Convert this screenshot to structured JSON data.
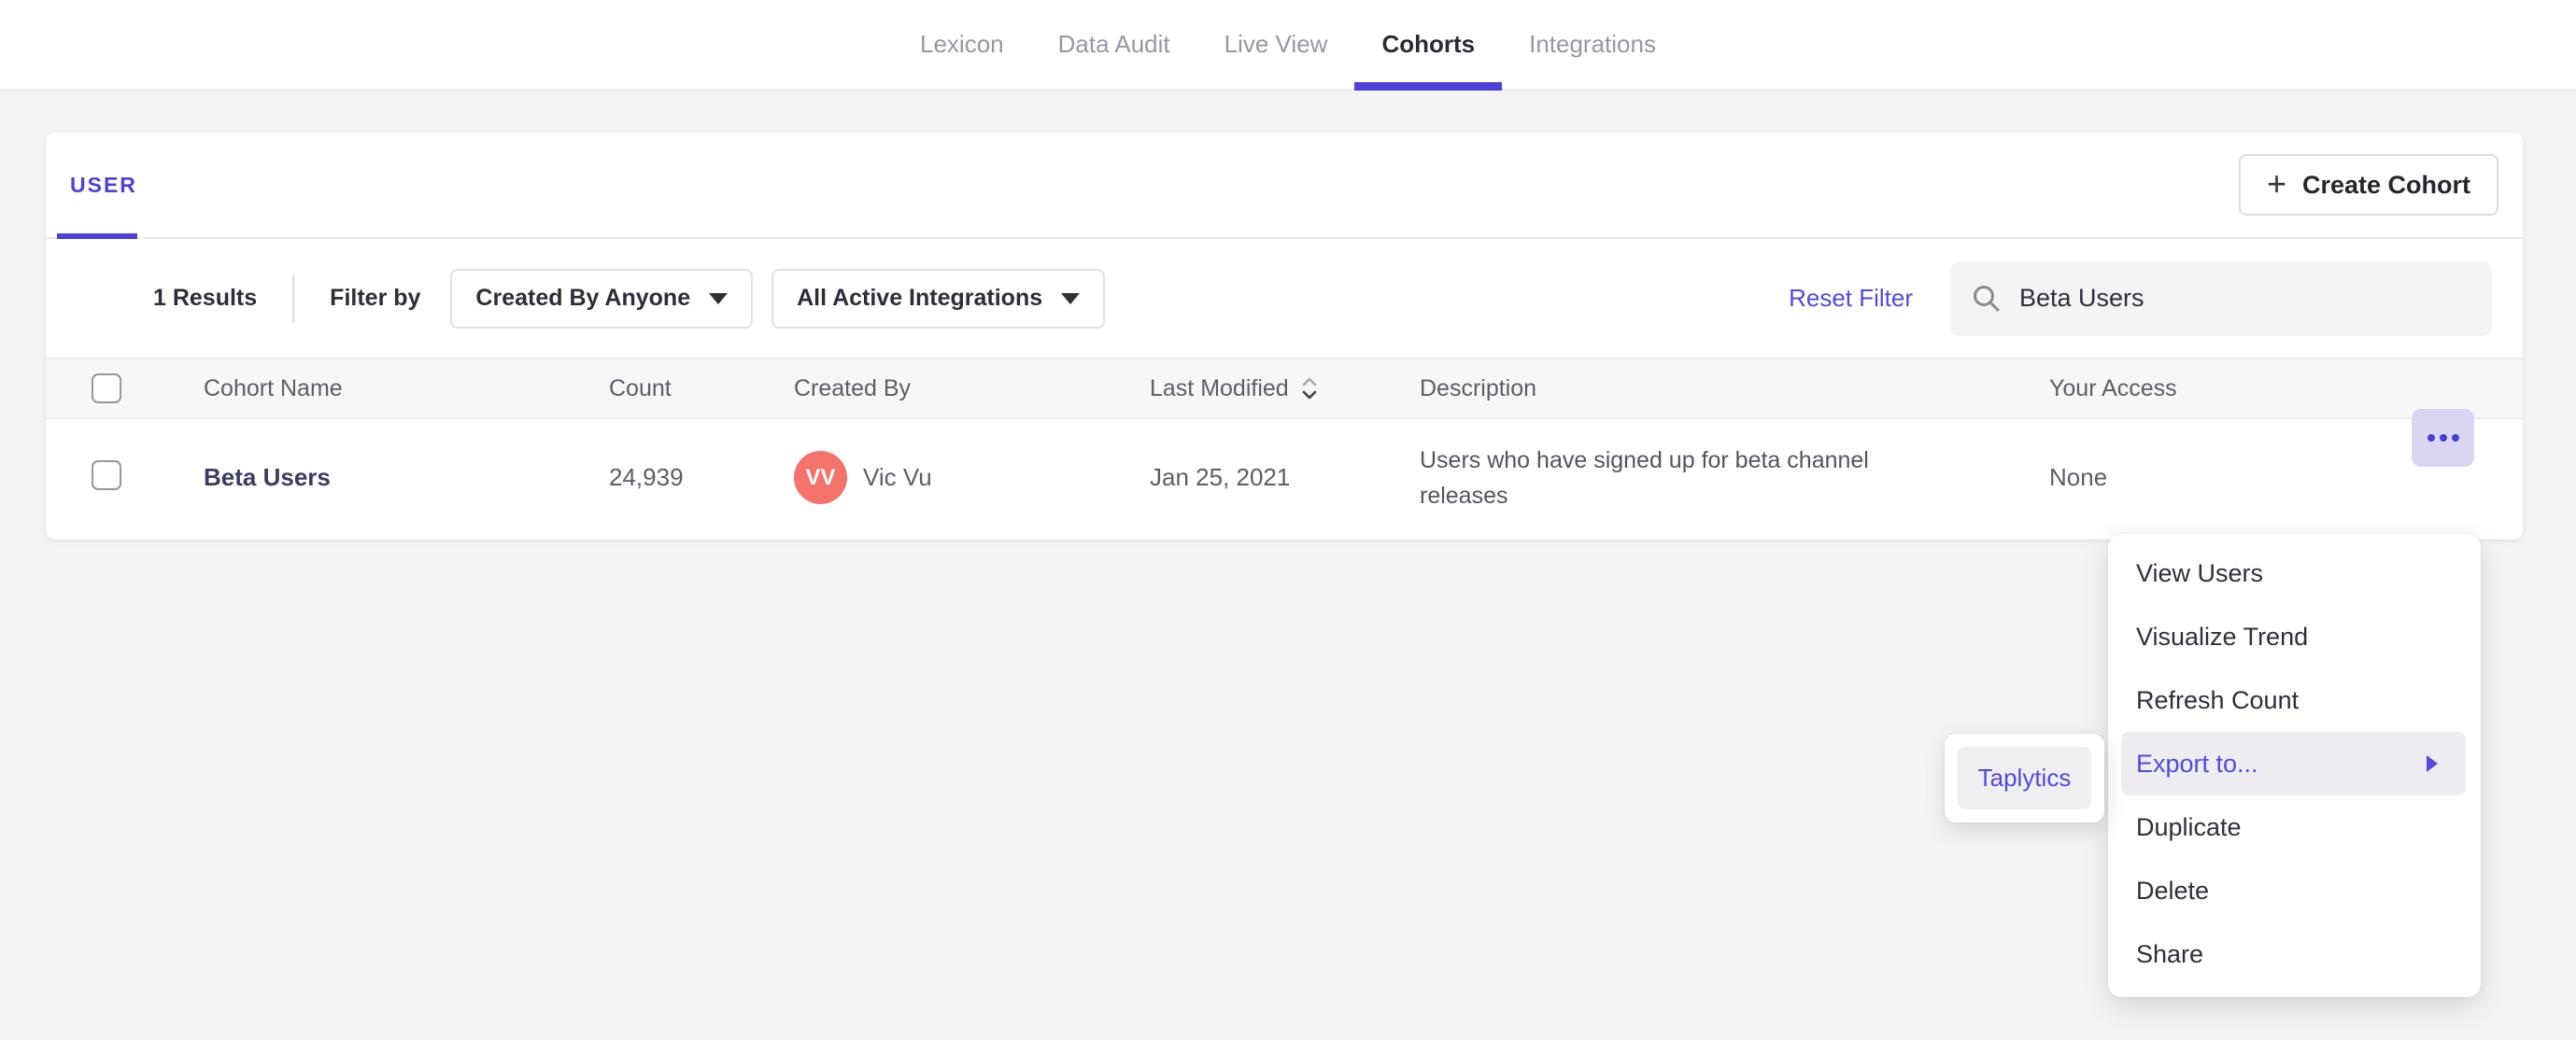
{
  "nav": {
    "tabs": [
      {
        "label": "Lexicon",
        "active": false
      },
      {
        "label": "Data Audit",
        "active": false
      },
      {
        "label": "Live View",
        "active": false
      },
      {
        "label": "Cohorts",
        "active": true
      },
      {
        "label": "Integrations",
        "active": false
      }
    ]
  },
  "card": {
    "tab_label": "USER",
    "create_button": {
      "plus": "+",
      "label": "Create Cohort"
    },
    "filter_bar": {
      "results_count": "1 Results",
      "filter_by_label": "Filter by",
      "dropdowns": [
        {
          "label": "Created By Anyone"
        },
        {
          "label": "All Active Integrations"
        }
      ],
      "reset_filter_label": "Reset Filter",
      "search": {
        "value": "Beta Users",
        "icon": "search-icon"
      }
    },
    "table": {
      "columns": [
        "Cohort Name",
        "Count",
        "Created By",
        "Last Modified",
        "Description",
        "Your Access"
      ],
      "sort_column": "Last Modified",
      "rows": [
        {
          "name": "Beta Users",
          "count": "24,939",
          "created_by": {
            "initials": "VV",
            "name": "Vic Vu",
            "avatar_color": "#f4736b"
          },
          "last_modified": "Jan 25, 2021",
          "description": "Users who have signed up for beta channel releases",
          "access": "None"
        }
      ]
    }
  },
  "context_menu": {
    "items": [
      {
        "label": "View Users",
        "highlighted": false
      },
      {
        "label": "Visualize Trend",
        "highlighted": false
      },
      {
        "label": "Refresh Count",
        "highlighted": false
      },
      {
        "label": "Export to...",
        "highlighted": true,
        "has_submenu": true
      },
      {
        "label": "Duplicate",
        "highlighted": false
      },
      {
        "label": "Delete",
        "highlighted": false
      },
      {
        "label": "Share",
        "highlighted": false
      }
    ],
    "submenu": {
      "items": [
        {
          "label": "Taplytics",
          "highlighted": true
        }
      ]
    }
  },
  "colors": {
    "accent_purple": "#4b40d9",
    "link_purple": "#5348e1",
    "avatar_salmon": "#f4736b",
    "more_button_bg": "#d9d5f3",
    "page_bg": "#f4f4f5",
    "table_header_bg": "#f7f7f8",
    "menu_highlight_bg": "#ededf1"
  }
}
